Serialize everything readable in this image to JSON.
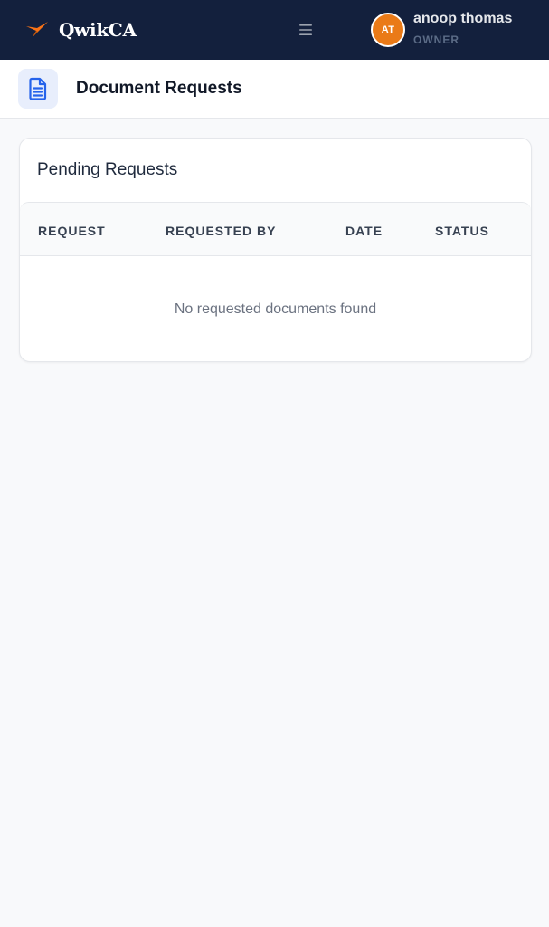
{
  "app": {
    "logo_text": "QwikCA",
    "brand_color": "#13203d",
    "accent_color": "#f97316"
  },
  "topbar": {
    "menu_icon": "hamburger-icon",
    "user": {
      "initials": "AT",
      "name": "anoop thomas",
      "role": "OWNER",
      "avatar_color": "#ea7a17"
    }
  },
  "page": {
    "icon": "document-icon",
    "title": "Document Requests"
  },
  "pending": {
    "title": "Pending Requests",
    "columns": [
      "REQUEST",
      "REQUESTED BY",
      "DATE",
      "STATUS"
    ],
    "rows": [],
    "empty_message": "No requested documents found"
  }
}
